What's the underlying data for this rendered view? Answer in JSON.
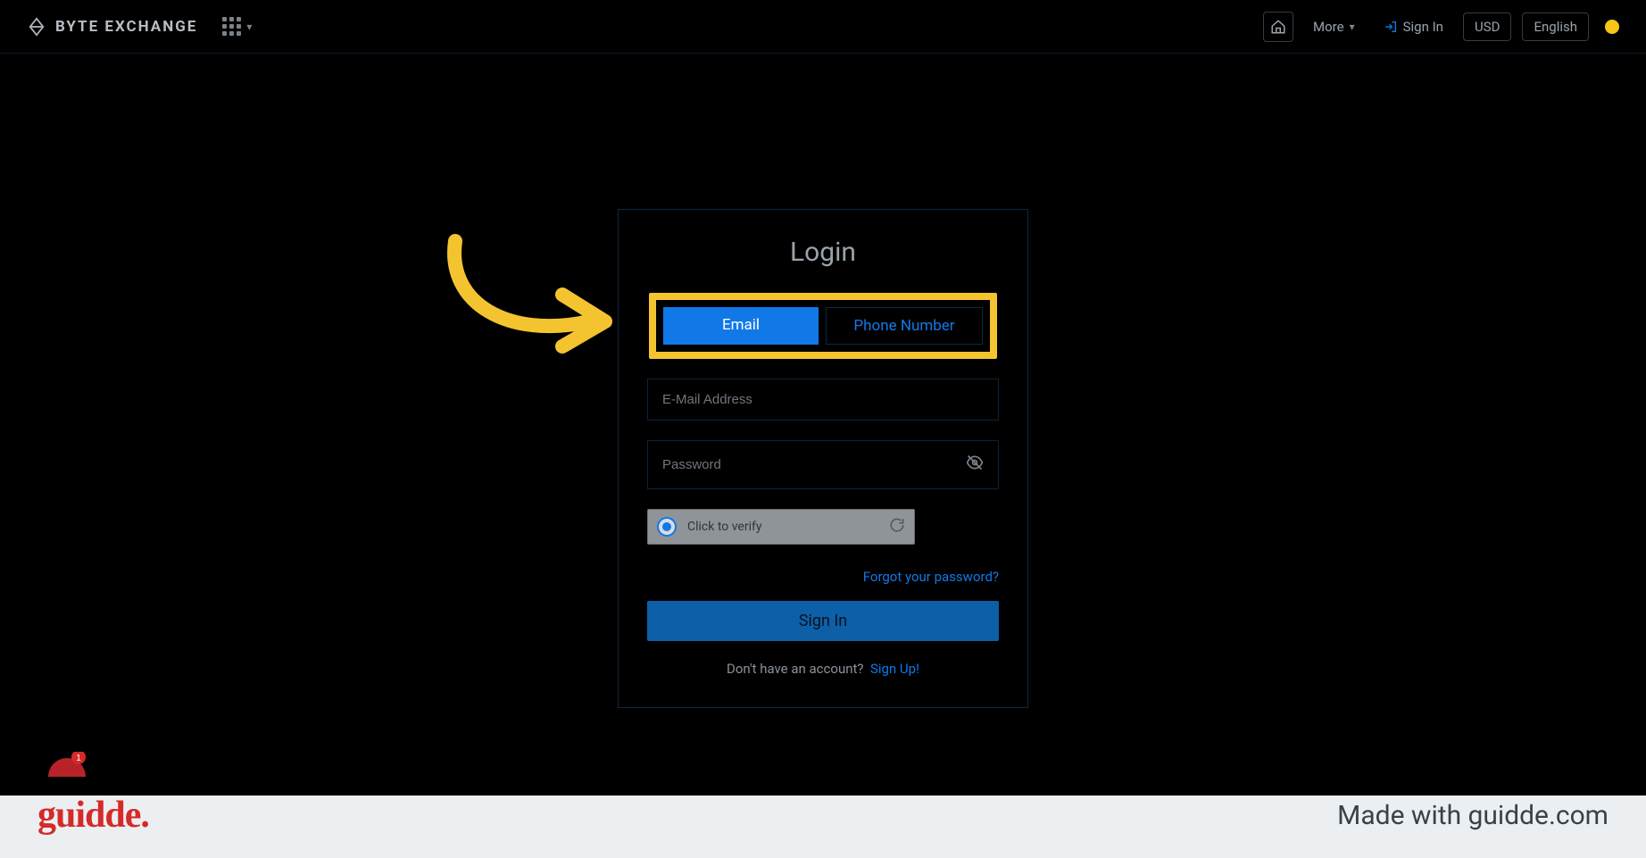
{
  "nav": {
    "brand": "BYTE EXCHANGE",
    "more": "More",
    "signin": "Sign In",
    "currency": "USD",
    "language": "English"
  },
  "login": {
    "title": "Login",
    "tab_email": "Email",
    "tab_phone": "Phone Number",
    "email_placeholder": "E-Mail Address",
    "password_placeholder": "Password",
    "captcha": "Click to verify",
    "forgot": "Forgot your password?",
    "signin_btn": "Sign In",
    "noaccount": "Don't have an account?",
    "signup": "Sign Up!"
  },
  "footer": {
    "logo": "guidde.",
    "made": "Made with guidde.com"
  },
  "badge": {
    "count": "1"
  }
}
